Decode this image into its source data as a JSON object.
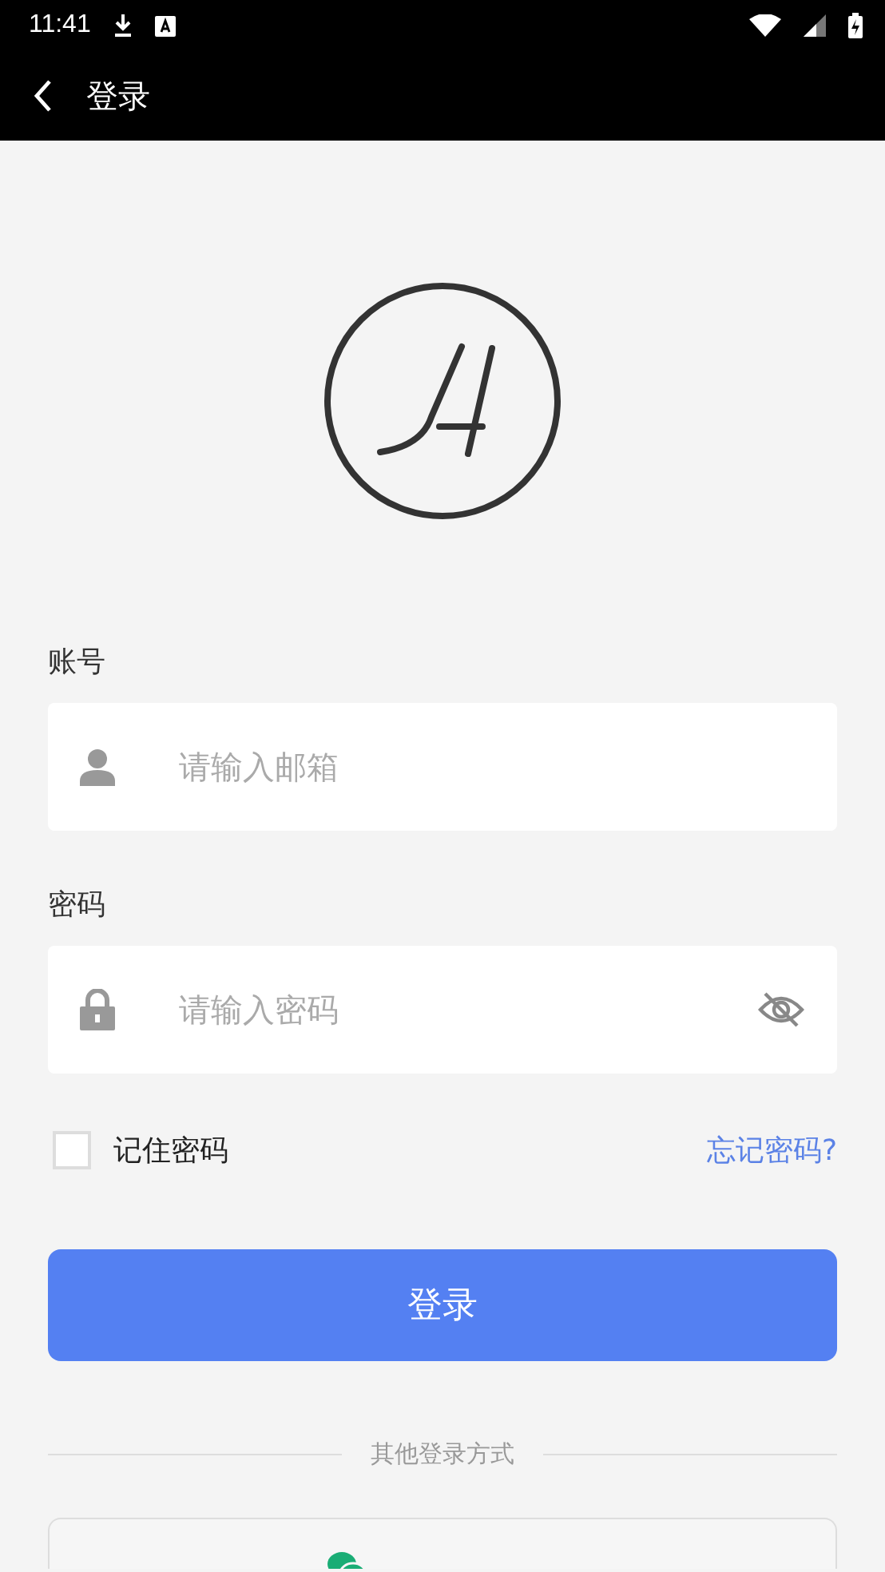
{
  "status_bar": {
    "time": "11:41"
  },
  "app_bar": {
    "title": "登录"
  },
  "fields": [
    {
      "kind": "account",
      "label": "账号",
      "placeholder": "请输入邮箱"
    },
    {
      "kind": "password",
      "label": "密码",
      "placeholder": "请输入密码"
    }
  ],
  "remember": {
    "label": "记住密码",
    "checked": false
  },
  "forgot_link": "忘记密码?",
  "login_button": "登录",
  "divider_text": "其他登录方式",
  "wechat_button": {
    "kind": "wechat"
  }
}
